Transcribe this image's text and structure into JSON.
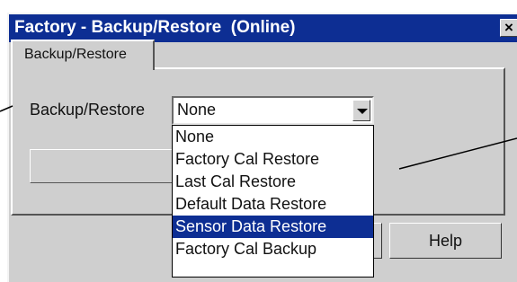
{
  "window": {
    "title": "Factory - Backup/Restore  (Online)",
    "close_label": "×"
  },
  "tabs": [
    {
      "label": "Backup/Restore"
    }
  ],
  "form": {
    "field_label": "Backup/Restore",
    "selected_value": "None"
  },
  "dropdown": {
    "options": [
      {
        "label": "None"
      },
      {
        "label": "Factory Cal Restore"
      },
      {
        "label": "Last Cal Restore"
      },
      {
        "label": "Default Data Restore"
      },
      {
        "label": "Sensor Data Restore",
        "highlighted": true
      },
      {
        "label": "Factory Cal Backup"
      }
    ]
  },
  "buttons": {
    "help_label": "Help"
  },
  "colors": {
    "titlebar": "#0d2e93",
    "window_face": "#cfcfcf",
    "highlight": "#0d2e93"
  }
}
